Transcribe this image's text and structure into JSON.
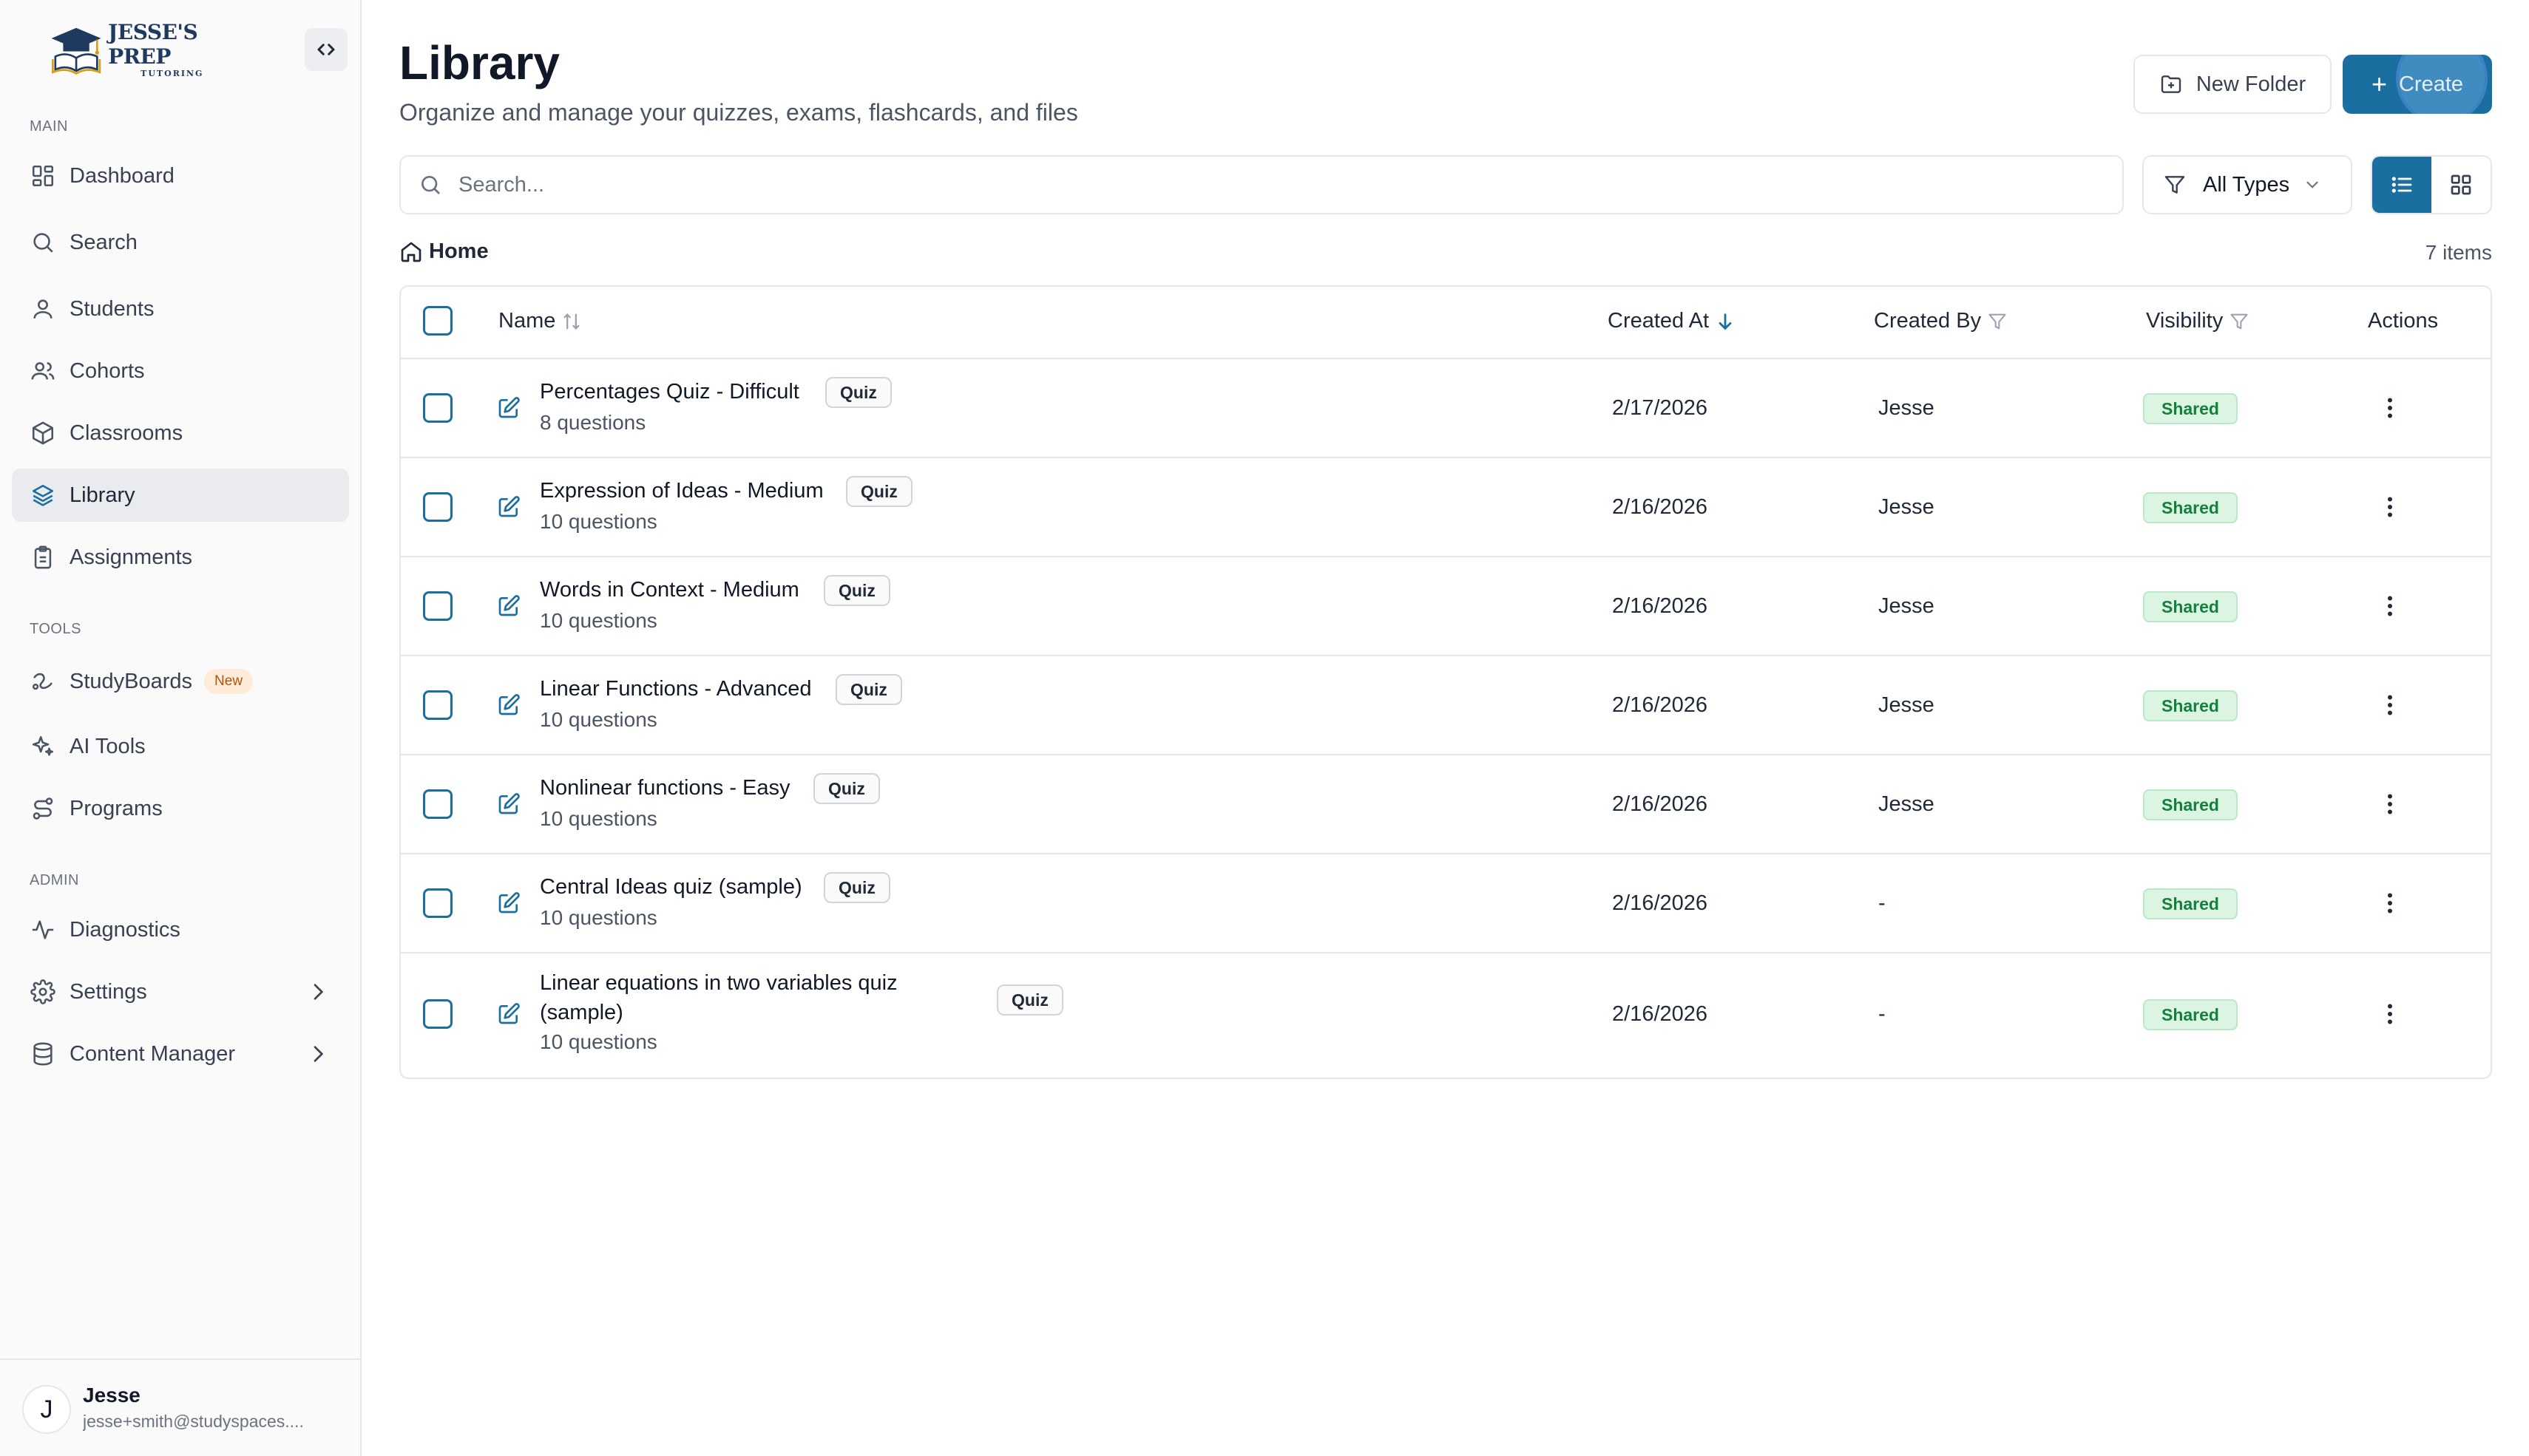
{
  "sidebar": {
    "logo": {
      "title": "JESSE'S PREP",
      "subtitle": "TUTORING"
    },
    "sections": {
      "main": "MAIN",
      "tools": "TOOLS",
      "admin": "ADMIN"
    },
    "items": [
      {
        "label": "Dashboard",
        "icon": "dashboard-icon"
      },
      {
        "label": "Search",
        "icon": "search-icon"
      },
      {
        "label": "Students",
        "icon": "user-icon"
      },
      {
        "label": "Cohorts",
        "icon": "users-icon"
      },
      {
        "label": "Classrooms",
        "icon": "cube-icon"
      },
      {
        "label": "Library",
        "icon": "layers-icon",
        "active": true
      },
      {
        "label": "Assignments",
        "icon": "clipboard-icon"
      },
      {
        "label": "StudyBoards",
        "icon": "whiteboard-icon",
        "badge": "New"
      },
      {
        "label": "AI Tools",
        "icon": "sparkles-icon"
      },
      {
        "label": "Programs",
        "icon": "route-icon"
      },
      {
        "label": "Diagnostics",
        "icon": "activity-icon"
      },
      {
        "label": "Settings",
        "icon": "gear-icon"
      },
      {
        "label": "Content Manager",
        "icon": "database-icon"
      }
    ],
    "user": {
      "initial": "J",
      "name": "Jesse",
      "email": "jesse+smith@studyspaces...."
    }
  },
  "header": {
    "title": "Library",
    "subtitle": "Organize and manage your quizzes, exams, flashcards, and files",
    "new_folder_label": "New Folder",
    "create_label": "Create",
    "create_plus": "+"
  },
  "toolbar": {
    "search_placeholder": "Search...",
    "type_filter": "All Types",
    "active_view": "list"
  },
  "breadcrumb": {
    "home": "Home"
  },
  "item_count": "7 items",
  "table": {
    "columns": {
      "name": "Name",
      "created_at": "Created At",
      "created_by": "Created By",
      "visibility": "Visibility",
      "actions": "Actions"
    },
    "rows": [
      {
        "name": "Percentages Quiz - Difficult",
        "type": "Quiz",
        "questions": "8 questions",
        "created_at": "2/17/2026",
        "created_by": "Jesse",
        "visibility": "Shared"
      },
      {
        "name": "Expression of Ideas - Medium",
        "type": "Quiz",
        "questions": "10 questions",
        "created_at": "2/16/2026",
        "created_by": "Jesse",
        "visibility": "Shared"
      },
      {
        "name": "Words in Context - Medium",
        "type": "Quiz",
        "questions": "10 questions",
        "created_at": "2/16/2026",
        "created_by": "Jesse",
        "visibility": "Shared"
      },
      {
        "name": "Linear Functions - Advanced",
        "type": "Quiz",
        "questions": "10 questions",
        "created_at": "2/16/2026",
        "created_by": "Jesse",
        "visibility": "Shared"
      },
      {
        "name": "Nonlinear functions - Easy",
        "type": "Quiz",
        "questions": "10 questions",
        "created_at": "2/16/2026",
        "created_by": "Jesse",
        "visibility": "Shared"
      },
      {
        "name": "Central Ideas quiz (sample)",
        "type": "Quiz",
        "questions": "10 questions",
        "created_at": "2/16/2026",
        "created_by": "-",
        "visibility": "Shared"
      },
      {
        "name_line1": "Linear equations in two variables quiz",
        "name_line2": "(sample)",
        "type": "Quiz",
        "questions": "10 questions",
        "created_at": "2/16/2026",
        "created_by": "-",
        "visibility": "Shared"
      }
    ]
  },
  "colors": {
    "accent": "#1a6ea0",
    "shared_bg": "#dcf5e3",
    "shared_text": "#15803d",
    "new_badge_bg": "#fdecd8"
  }
}
